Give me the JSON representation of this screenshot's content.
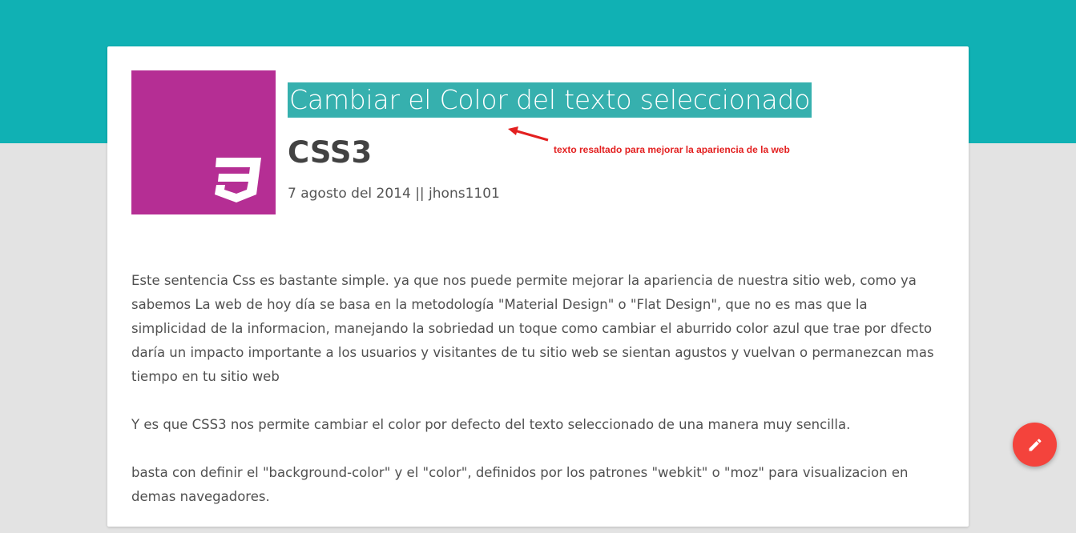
{
  "post": {
    "title": "Cambiar el Color del texto seleccionado",
    "category": "CSS3",
    "meta": "7 agosto del 2014 || jhons1101",
    "logo_icon": "css3-icon",
    "paragraphs": [
      "Este sentencia Css es bastante simple. ya que nos puede permite mejorar la apariencia de nuestra sitio web, como ya sabemos La web de hoy día se basa en la metodología \"Material Design\" o \"Flat Design\", que no es mas que la simplicidad de la informacion, manejando la sobriedad un toque como cambiar el aburrido color azul que trae por dfecto daría un impacto importante a los usuarios y visitantes de tu sitio web se sientan agustos y vuelvan o permanezcan mas tiempo en tu sitio web",
      "Y es que CSS3 nos permite cambiar el color por defecto del texto seleccionado de una manera muy sencilla.",
      "basta con definir el \"background-color\" y el \"color\", definidos por los patrones \"webkit\" o \"moz\" para visualizacion en demas navegadores."
    ]
  },
  "annotation": {
    "text": "texto resaltado para mejorar la apariencia de la web",
    "color": "#e32020"
  },
  "fab": {
    "icon": "pencil-icon",
    "color": "#f4433c"
  },
  "colors": {
    "header_band": "#10b1b4",
    "logo_tile": "#b52e94",
    "highlight": "#36b0ae",
    "background": "#e3e3e3"
  }
}
